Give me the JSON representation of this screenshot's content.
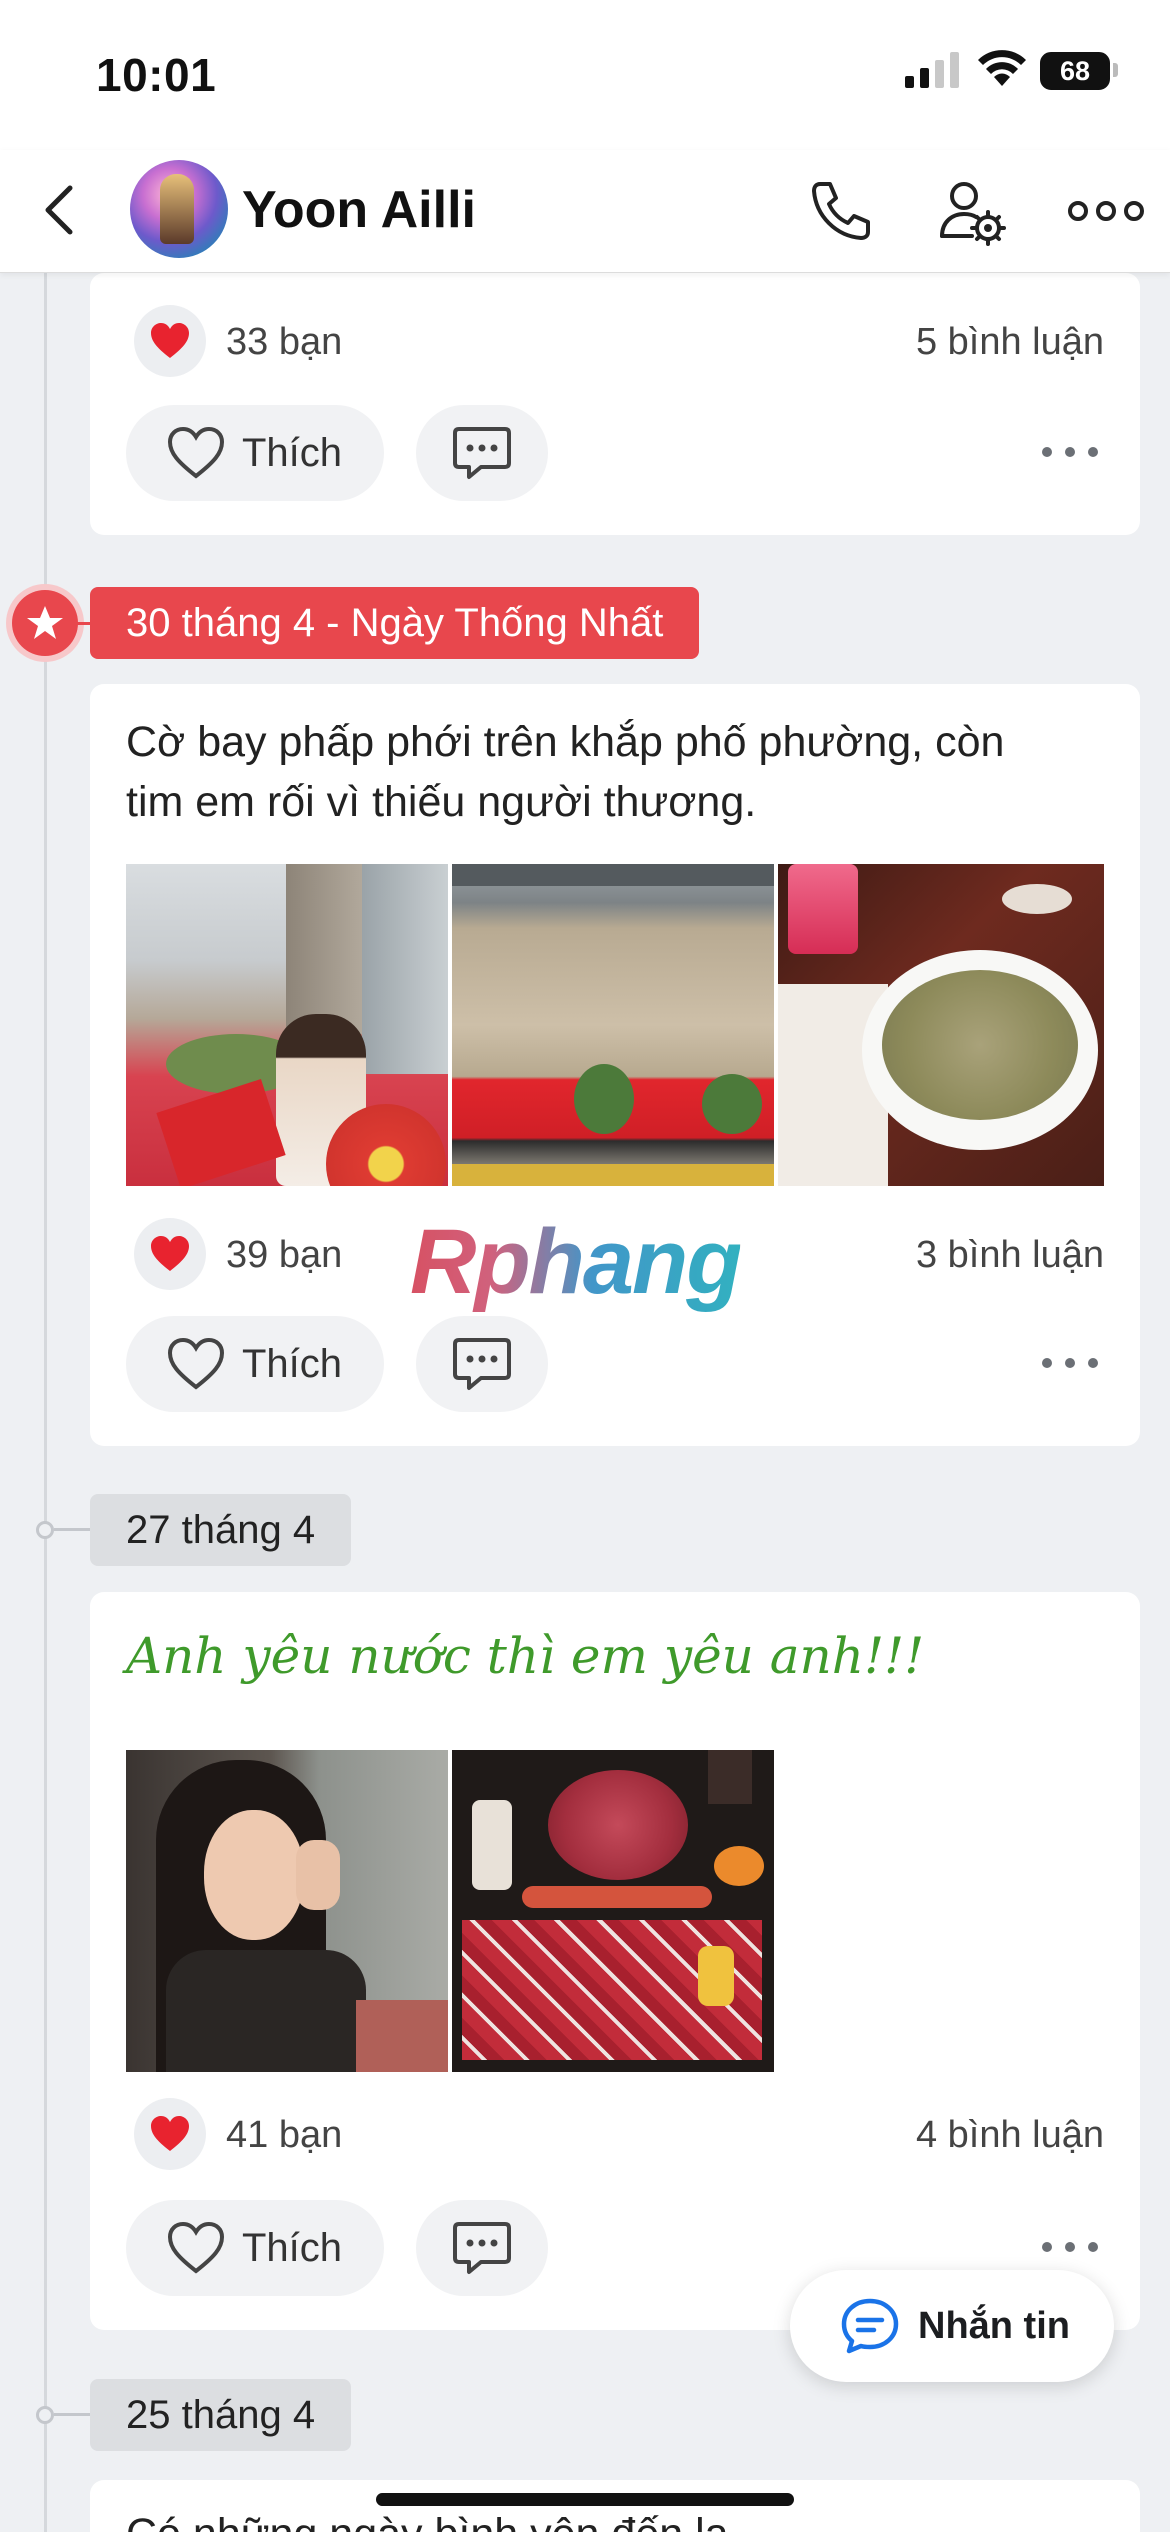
{
  "status_bar": {
    "time": "10:01",
    "battery": "68"
  },
  "header": {
    "name": "Yoon Ailli"
  },
  "colors": {
    "accent_red": "#e8474d",
    "fancy_green": "#3f9a2b",
    "blue_icon": "#1a73e8"
  },
  "posts": [
    {
      "reactions": "33 bạn",
      "comments": "5 bình luận",
      "like_label": "Thích"
    },
    {
      "date_tag": "30 tháng 4 - Ngày Thống Nhất",
      "text_line1": "Cờ bay phấp phới trên khắp phố phường, còn",
      "text_line2": "tim em rối vì thiếu người thương.",
      "reactions": "39 bạn",
      "comments": "3 bình luận",
      "like_label": "Thích"
    },
    {
      "date_tag": "27 tháng 4",
      "text": "Anh yêu nước thì em yêu anh!!!",
      "reactions": "41 bạn",
      "comments": "4 bình luận",
      "like_label": "Thích"
    },
    {
      "date_tag": "25 tháng 4",
      "text_partial": "Có những ngày bình yên đến lạ"
    }
  ],
  "watermark": "Rphang",
  "floating_button": {
    "label": "Nhắn tin",
    "icon": "chat-bubble-icon"
  }
}
